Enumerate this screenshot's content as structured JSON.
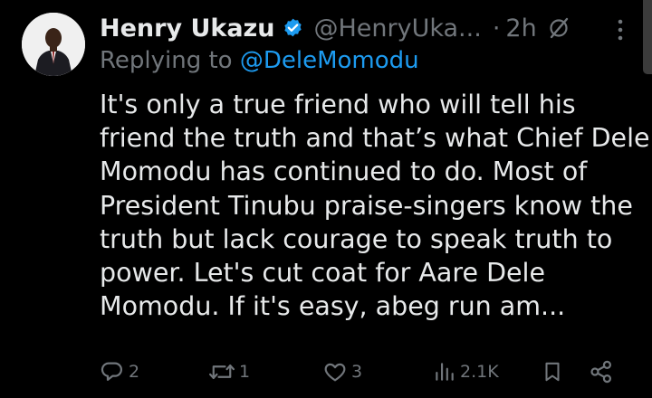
{
  "tweet": {
    "author_name": "Henry Ukazu",
    "handle": "@HenryUka...",
    "separator": "·",
    "time": "2h",
    "replying_prefix": "Replying to",
    "replying_to": "@DeleMomodu",
    "body_lines": [
      "It's only a true friend who will tell his",
      "friend the truth and that’s what Chief Dele",
      "Momodu has continued to do. Most of",
      "President Tinubu praise-singers know the",
      "truth but lack courage to speak truth to",
      "power. Let's cut coat for Aare  Dele",
      "Momodu. If it's easy, abeg run am..."
    ]
  },
  "actions": {
    "replies": "2",
    "reposts": "1",
    "likes": "3",
    "views": "2.1K"
  },
  "icons": {
    "verified": "verified-badge-icon",
    "grok": "grok-icon",
    "more": "more-vertical-icon",
    "reply": "reply-icon",
    "repost": "repost-icon",
    "like": "heart-icon",
    "views": "views-icon",
    "bookmark": "bookmark-icon",
    "share": "share-icon"
  },
  "colors": {
    "background": "#000000",
    "text": "#e7e9ea",
    "secondary": "#71767b",
    "accent": "#1d9bf0"
  }
}
